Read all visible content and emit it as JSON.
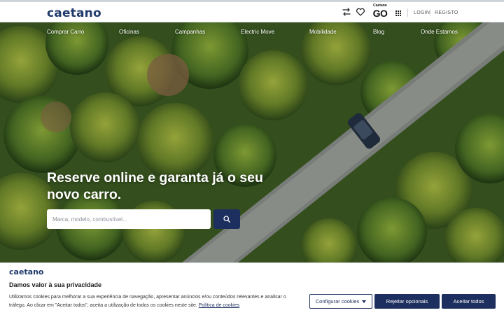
{
  "header": {
    "logo": "caetano",
    "go_logo_small": "Caetano",
    "go_logo_big": "GO",
    "login": "LOGIN",
    "register": "REGISTO",
    "icons": [
      "compare-arrows-icon",
      "heart-icon",
      "grid-apps-icon"
    ]
  },
  "nav": {
    "items": [
      "Comprar Carro",
      "Oficinas",
      "Campanhas",
      "Electric Move",
      "Mobilidade",
      "Blog",
      "Onde Estamos"
    ]
  },
  "hero": {
    "headline": "Reserve online e garanta já o seu novo carro.",
    "search_placeholder": "Marca, modelo, combustível...",
    "search_icon": "search-icon"
  },
  "cookie": {
    "logo": "caetano",
    "title": "Damos valor à sua privacidade",
    "text": "Utilizamos cookies para melhorar a sua experiência de navegação, apresentar anúncios e/ou conteúdos relevantes e analisar o tráfego. Ao clicar em \"Aceitar todos\", aceita a utilização de todos os cookies neste site.",
    "policy_link": "Política de cookies",
    "configure_button": "Configurar cookies",
    "reject_button": "Rejeitar opcionais",
    "accept_button": "Aceitar todos"
  },
  "colors": {
    "brand": "#1f3a6b",
    "button_primary": "#1d2f5e",
    "white": "#ffffff"
  }
}
